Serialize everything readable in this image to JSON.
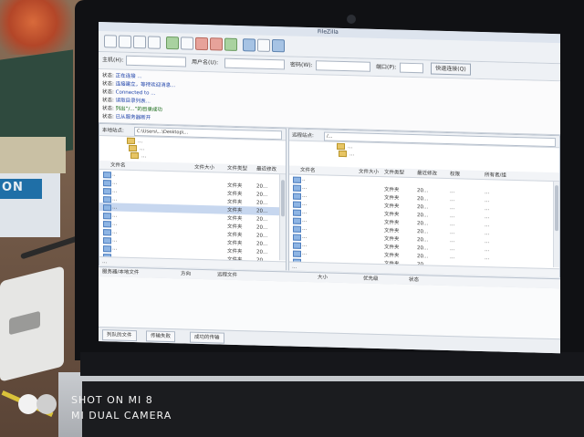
{
  "photo": {
    "book_spine_text": "ON",
    "watermark_line1": "SHOT ON MI 8",
    "watermark_line2": "MI DUAL CAMERA"
  },
  "app": {
    "title": "FileZilla",
    "quickconnect": {
      "host_label": "主机(H):",
      "user_label": "用户名(U):",
      "password_label": "密码(W):",
      "port_label": "端口(P):",
      "connect_button": "快速连接(Q)"
    },
    "log": [
      {
        "label": "状态:",
        "text": "正在连接 ...",
        "kind": "blue"
      },
      {
        "label": "状态:",
        "text": "连接建立，等待欢迎消息...",
        "kind": "blue"
      },
      {
        "label": "状态:",
        "text": "Connected to ...",
        "kind": "blue"
      },
      {
        "label": "状态:",
        "text": "读取目录列表...",
        "kind": "blue"
      },
      {
        "label": "状态:",
        "text": "列出“/...”的目录成功",
        "kind": "green"
      },
      {
        "label": "状态:",
        "text": "已从服务器断开",
        "kind": "blue"
      }
    ],
    "local": {
      "path_label": "本地站点:",
      "path": "C:\\Users\\...\\Desktop\\...",
      "tree": [
        "...",
        "...",
        "..."
      ],
      "headers": [
        "文件名",
        "文件大小",
        "文件类型",
        "最近修改"
      ],
      "files": [
        {
          "name": "..",
          "size": "",
          "type": ""
        },
        {
          "name": "...",
          "size": "",
          "type": "文件夹",
          "date": "20..."
        },
        {
          "name": "...",
          "size": "",
          "type": "文件夹",
          "date": "20..."
        },
        {
          "name": "...",
          "size": "",
          "type": "文件夹",
          "date": "20..."
        },
        {
          "name": "...",
          "size": "",
          "type": "文件夹",
          "date": "20..."
        },
        {
          "name": "...",
          "size": "",
          "type": "文件夹",
          "date": "20..."
        },
        {
          "name": "...",
          "size": "",
          "type": "文件夹",
          "date": "20..."
        },
        {
          "name": "...",
          "size": "",
          "type": "文件夹",
          "date": "20..."
        },
        {
          "name": "...",
          "size": "",
          "type": "文件夹",
          "date": "20..."
        },
        {
          "name": "...",
          "size": "",
          "type": "文件夹",
          "date": "20..."
        },
        {
          "name": "...",
          "size": "",
          "type": "文件夹",
          "date": "20..."
        }
      ],
      "selected_index": 4,
      "status": "..."
    },
    "remote": {
      "path_label": "远程站点:",
      "path": "/...",
      "tree": [
        "...",
        "..."
      ],
      "headers": [
        "文件名",
        "文件大小",
        "文件类型",
        "最近修改",
        "权限",
        "所有者/组"
      ],
      "files": [
        {
          "name": "..",
          "type": "",
          "date": "",
          "perm": "",
          "owner": ""
        },
        {
          "name": "...",
          "type": "文件夹",
          "date": "20...",
          "perm": "...",
          "owner": "..."
        },
        {
          "name": "...",
          "type": "文件夹",
          "date": "20...",
          "perm": "...",
          "owner": "..."
        },
        {
          "name": "...",
          "type": "文件夹",
          "date": "20...",
          "perm": "...",
          "owner": "..."
        },
        {
          "name": "...",
          "type": "文件夹",
          "date": "20...",
          "perm": "...",
          "owner": "..."
        },
        {
          "name": "...",
          "type": "文件夹",
          "date": "20...",
          "perm": "...",
          "owner": "..."
        },
        {
          "name": "...",
          "type": "文件夹",
          "date": "20...",
          "perm": "...",
          "owner": "..."
        },
        {
          "name": "...",
          "type": "文件夹",
          "date": "20...",
          "perm": "...",
          "owner": "..."
        },
        {
          "name": "...",
          "type": "文件夹",
          "date": "20...",
          "perm": "...",
          "owner": "..."
        },
        {
          "name": "...",
          "type": "文件夹",
          "date": "20...",
          "perm": "...",
          "owner": "..."
        },
        {
          "name": "...",
          "type": "文件夹",
          "date": "20...",
          "perm": "...",
          "owner": "..."
        }
      ],
      "status": "..."
    },
    "queue": {
      "headers": [
        "服务器/本地文件",
        "方向",
        "远程文件",
        "大小",
        "优先级",
        "状态"
      ]
    },
    "tabs": [
      "列队的文件",
      "传输失败",
      "成功的传输"
    ]
  }
}
